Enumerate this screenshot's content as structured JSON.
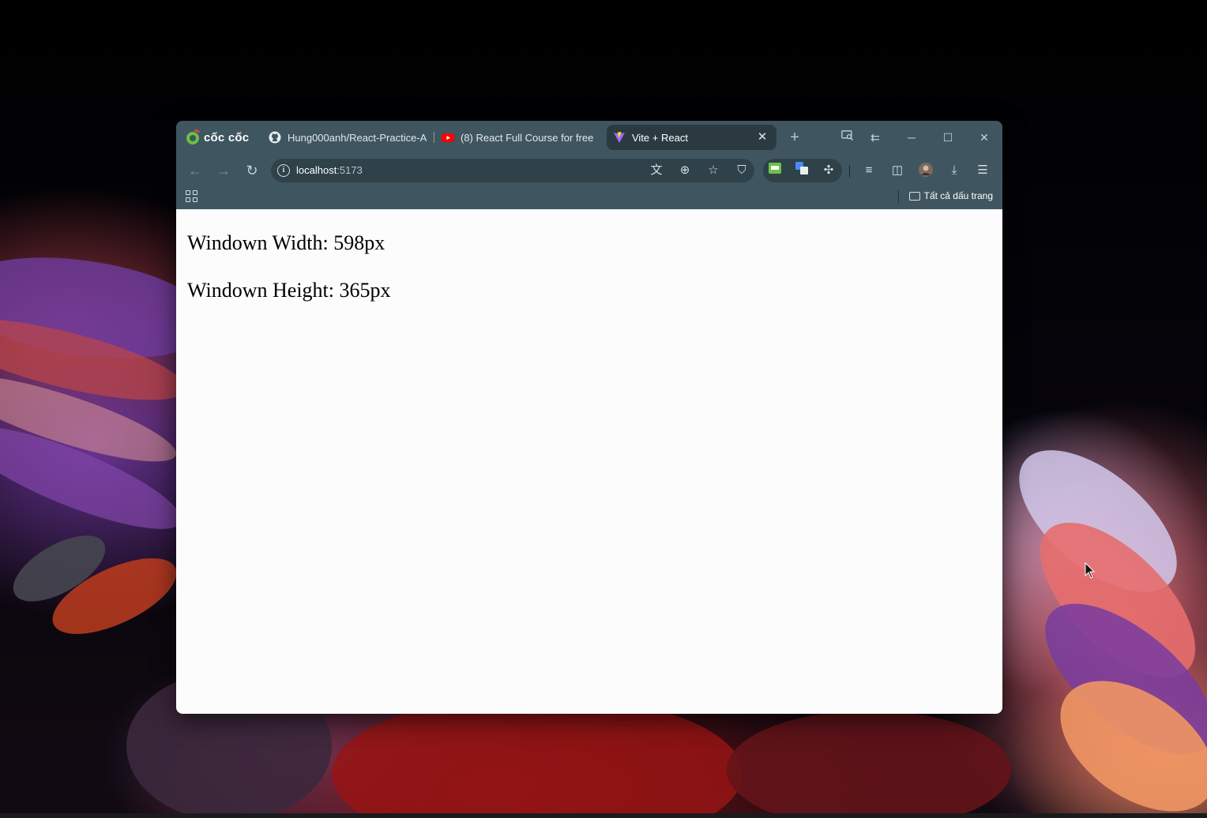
{
  "browser": {
    "logo_text": "cốc cốc",
    "tabs": [
      {
        "title": "Hung000anh/React-Practice-A",
        "icon": "github-icon",
        "active": false
      },
      {
        "title": "(8) React Full Course for free",
        "icon": "youtube-icon",
        "active": false
      },
      {
        "title": "Vite + React",
        "icon": "vite-icon",
        "active": true
      }
    ],
    "new_tab_label": "+",
    "address": {
      "host": "localhost",
      "port": ":5173"
    },
    "bookmarks": {
      "all_bookmarks_label": "Tất cả dấu trang"
    }
  },
  "page": {
    "width_text": "Windown Width: 598px",
    "height_text": "Windown Height: 365px"
  },
  "colors": {
    "browser_frame": "#3f5660",
    "active_tab": "#2b3a41",
    "omnibox": "#2f4149",
    "page_bg": "#fcfcfc"
  }
}
